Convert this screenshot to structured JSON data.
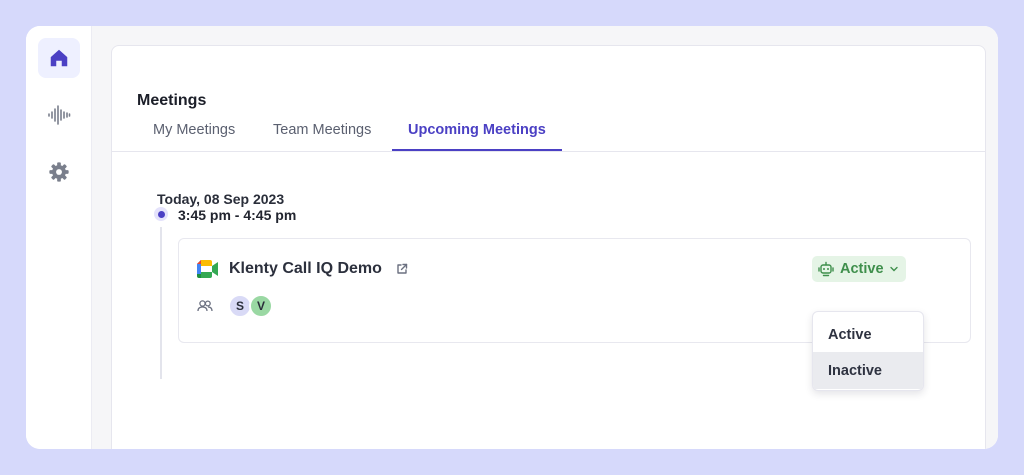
{
  "sidebar": {
    "items": [
      {
        "icon": "home-icon",
        "active": true
      },
      {
        "icon": "audio-wave-icon",
        "active": false
      },
      {
        "icon": "gear-icon",
        "active": false
      }
    ]
  },
  "panel": {
    "title": "Meetings",
    "tabs": [
      {
        "label": "My Meetings",
        "active": false
      },
      {
        "label": "Team Meetings",
        "active": false
      },
      {
        "label": "Upcoming Meetings",
        "active": true
      }
    ]
  },
  "schedule": {
    "date": "Today, 08 Sep 2023",
    "slot": {
      "time": "3:45 pm - 4:45 pm",
      "meeting": {
        "title": "Klenty Call IQ Demo",
        "platform_icon": "google-meet-icon",
        "participants": [
          "S",
          "V"
        ],
        "bot_status": "Active"
      }
    }
  },
  "status_dropdown": {
    "options": [
      "Active",
      "Inactive"
    ],
    "highlighted": "Inactive"
  },
  "colors": {
    "accent": "#4b40c4",
    "active_green": "#3f8f4c",
    "active_green_bg": "#e5f4e6",
    "page_bg": "#d6d9fb"
  }
}
